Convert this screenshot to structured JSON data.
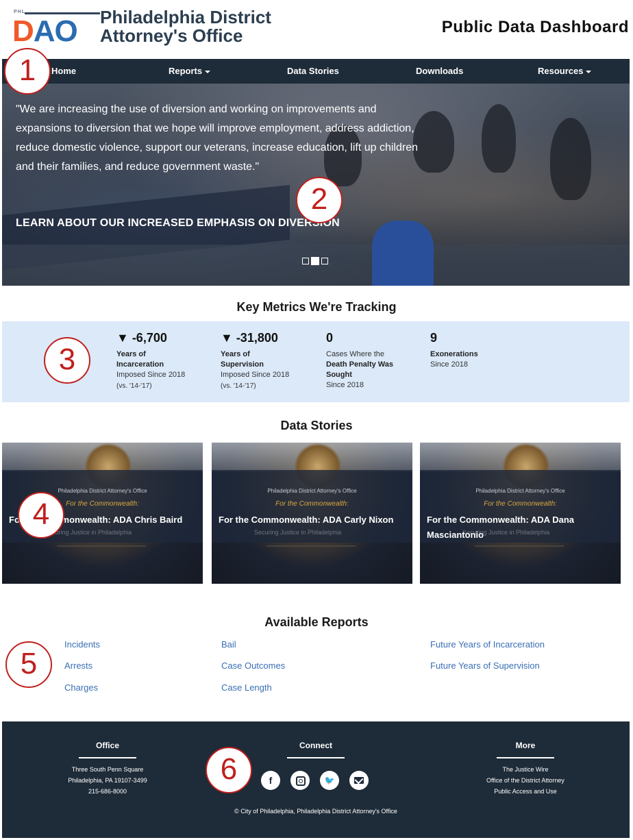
{
  "header": {
    "logo_small": "PHL",
    "logo_d": "D",
    "logo_ao": "AO",
    "org_name_line1": "Philadelphia District",
    "org_name_line2": "Attorney's Office",
    "dashboard_title": "Public Data Dashboard"
  },
  "nav": {
    "items": [
      {
        "label": "Home",
        "has_dropdown": false
      },
      {
        "label": "Reports",
        "has_dropdown": true
      },
      {
        "label": "Data Stories",
        "has_dropdown": false
      },
      {
        "label": "Downloads",
        "has_dropdown": false
      },
      {
        "label": "Resources",
        "has_dropdown": true
      }
    ]
  },
  "hero": {
    "quote": "\"We are increasing the use of diversion and working on improvements and expansions to diversion that we hope will improve employment, address addiction, reduce domestic violence, support our veterans, increase education, lift up children and their families, and reduce government waste.\"",
    "cta": "LEARN ABOUT OUR INCREASED EMPHASIS ON DIVERSION",
    "slides": 3,
    "active_slide": 2
  },
  "metrics": {
    "title": "Key Metrics We're Tracking",
    "items": [
      {
        "value": "▼ -6,700",
        "line1": "Years of",
        "line1b": "Incarceration",
        "line2": "Imposed Since 2018",
        "line3": "(vs. '14-'17)"
      },
      {
        "value": "▼ -31,800",
        "line1": "Years of",
        "line1b": "Supervision",
        "line2": "Imposed Since 2018",
        "line3": "(vs. '14-'17)"
      },
      {
        "value": "0",
        "line1": "Cases Where the",
        "line1b": "Death Penalty Was Sought",
        "line2": "Since 2018",
        "line3": ""
      },
      {
        "value": "9",
        "line1": "Exonerations",
        "line1b": "",
        "line2": "Since 2018",
        "line3": ""
      }
    ]
  },
  "stories": {
    "title": "Data Stories",
    "org": "Philadelphia District Attorney's Office",
    "subtitle": "For the Commonwealth:",
    "ghost": "Securing Justice in Philadelphia",
    "items": [
      {
        "title": "For the Commonwealth: ADA Chris Baird"
      },
      {
        "title": "For the Commonwealth: ADA Carly Nixon"
      },
      {
        "title": "For the Commonwealth: ADA Dana Masciantonio"
      }
    ]
  },
  "reports": {
    "title": "Available Reports",
    "col1": [
      "Incidents",
      "Arrests",
      "Charges"
    ],
    "col2": [
      "Bail",
      "Case Outcomes",
      "Case Length"
    ],
    "col3": [
      "Future Years of Incarceration",
      "Future Years of Supervision"
    ]
  },
  "footer": {
    "office": {
      "heading": "Office",
      "lines": [
        "Three South Penn Square",
        "Philadelphia, PA 19107-3499",
        "215-686-8000"
      ]
    },
    "connect": {
      "heading": "Connect",
      "icons": [
        "facebook-icon",
        "instagram-icon",
        "twitter-icon",
        "email-icon"
      ]
    },
    "more": {
      "heading": "More",
      "lines": [
        "The Justice Wire",
        "Office of the District Attorney",
        "Public Access and Use"
      ]
    },
    "copyright": "© City of Philadelphia, Philadelphia District Attorney's Office"
  },
  "markers": [
    "1",
    "2",
    "3",
    "4",
    "5",
    "6"
  ],
  "colors": {
    "nav_bg": "#1e2b38",
    "metrics_bg": "#dbe9f9",
    "link": "#3a6fb4",
    "marker": "#c0201d",
    "logo_orange": "#f05a28",
    "logo_blue": "#2b6cb0"
  }
}
